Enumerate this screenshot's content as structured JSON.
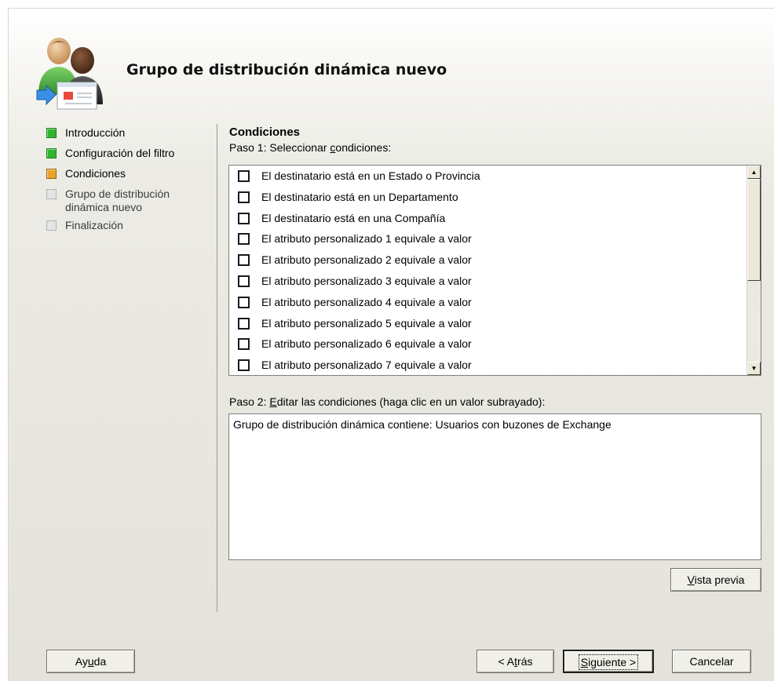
{
  "wizard": {
    "title": "Grupo de distribución dinámica nuevo",
    "header_icon": "users-mail-icon"
  },
  "nav": {
    "items": [
      {
        "label": "Introducción",
        "state": "done"
      },
      {
        "label": "Configuración del filtro",
        "state": "done"
      },
      {
        "label": "Condiciones",
        "state": "current"
      },
      {
        "label": "Grupo de distribución dinámica nuevo",
        "state": "pending"
      },
      {
        "label": "Finalización",
        "state": "pending"
      }
    ]
  },
  "main": {
    "section_title": "Condiciones",
    "step1": {
      "prefix": "Paso 1: Seleccionar ",
      "underlined": "c",
      "suffix": "ondiciones:"
    },
    "conditions": [
      "El destinatario está en un Estado o Provincia",
      "El destinatario está en un Departamento",
      "El destinatario está en una Compañía",
      "El atributo personalizado 1 equivale a valor",
      "El atributo personalizado 2 equivale a valor",
      "El atributo personalizado 3 equivale a valor",
      "El atributo personalizado 4 equivale a valor",
      "El atributo personalizado 5 equivale a valor",
      "El atributo personalizado 6 equivale a valor",
      "El atributo personalizado 7 equivale a valor"
    ],
    "step2": {
      "prefix": "Paso 2: ",
      "underlined": "E",
      "suffix": "ditar las condiciones (haga clic en un valor subrayado):"
    },
    "condition_text": "Grupo de distribución dinámica contiene: Usuarios con buzones de Exchange",
    "preview_button": {
      "underlined": "V",
      "rest": "ista previa"
    }
  },
  "footer": {
    "help": {
      "pre": "Ay",
      "underlined": "u",
      "post": "da"
    },
    "back": {
      "pre": "< A",
      "underlined": "t",
      "post": "rás"
    },
    "next": {
      "pre": "",
      "underlined": "S",
      "post": "iguiente >"
    },
    "cancel": "Cancelar"
  },
  "colors": {
    "done": "#2fb52f",
    "current": "#e8a32a",
    "pending": "#e4e4e4"
  }
}
